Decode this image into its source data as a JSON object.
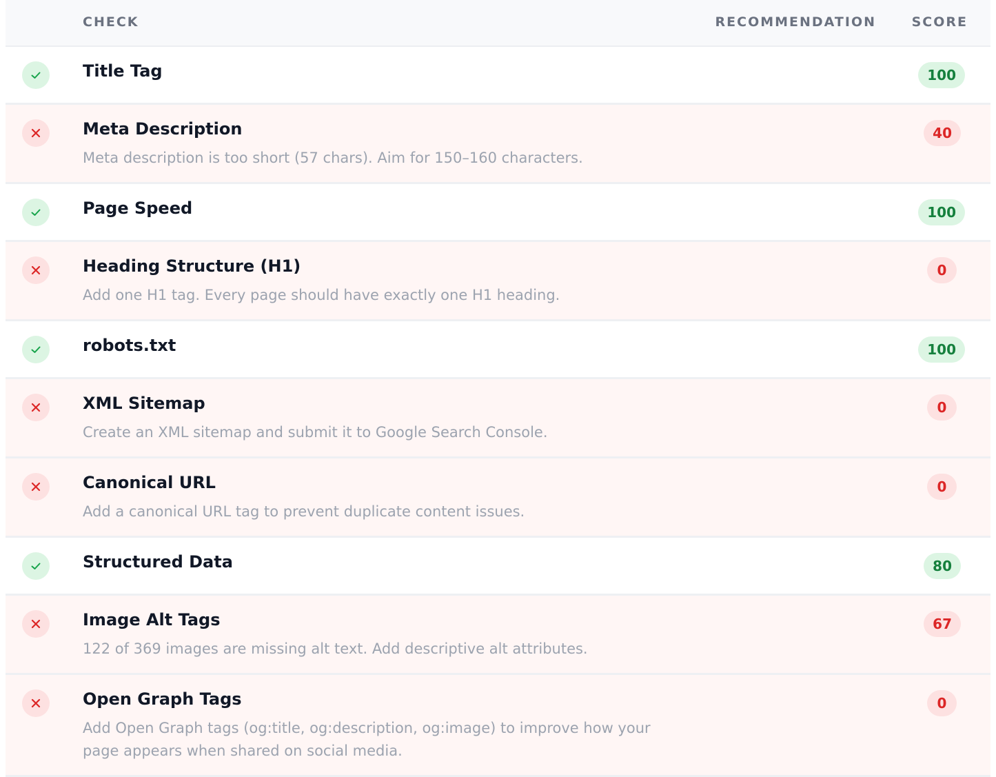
{
  "header": {
    "check": "CHECK",
    "recommendation": "RECOMMENDATION",
    "score": "SCORE"
  },
  "colors": {
    "pass": "#15803d",
    "pass_bg": "#dcf5e3",
    "fail": "#dc2626",
    "fail_bg": "#fde1e1",
    "fail_row_bg": "#fff6f5"
  },
  "rows": [
    {
      "title": "Title Tag",
      "desc": "",
      "score": "100",
      "status": "pass",
      "icon": "check-icon"
    },
    {
      "title": "Meta Description",
      "desc": "Meta description is too short (57 chars). Aim for 150–160 characters.",
      "score": "40",
      "status": "fail",
      "icon": "x-icon"
    },
    {
      "title": "Page Speed",
      "desc": "",
      "score": "100",
      "status": "pass",
      "icon": "check-icon"
    },
    {
      "title": "Heading Structure (H1)",
      "desc": "Add one H1 tag. Every page should have exactly one H1 heading.",
      "score": "0",
      "status": "fail",
      "icon": "x-icon"
    },
    {
      "title": "robots.txt",
      "desc": "",
      "score": "100",
      "status": "pass",
      "icon": "check-icon"
    },
    {
      "title": "XML Sitemap",
      "desc": "Create an XML sitemap and submit it to Google Search Console.",
      "score": "0",
      "status": "fail",
      "icon": "x-icon"
    },
    {
      "title": "Canonical URL",
      "desc": "Add a canonical URL tag to prevent duplicate content issues.",
      "score": "0",
      "status": "fail",
      "icon": "x-icon"
    },
    {
      "title": "Structured Data",
      "desc": "",
      "score": "80",
      "status": "pass",
      "icon": "check-icon"
    },
    {
      "title": "Image Alt Tags",
      "desc": "122 of 369 images are missing alt text. Add descriptive alt attributes.",
      "score": "67",
      "status": "fail",
      "icon": "x-icon"
    },
    {
      "title": "Open Graph Tags",
      "desc": "Add Open Graph tags (og:title, og:description, og:image) to improve how your page appears when shared on social media.",
      "score": "0",
      "status": "fail",
      "icon": "x-icon"
    }
  ]
}
